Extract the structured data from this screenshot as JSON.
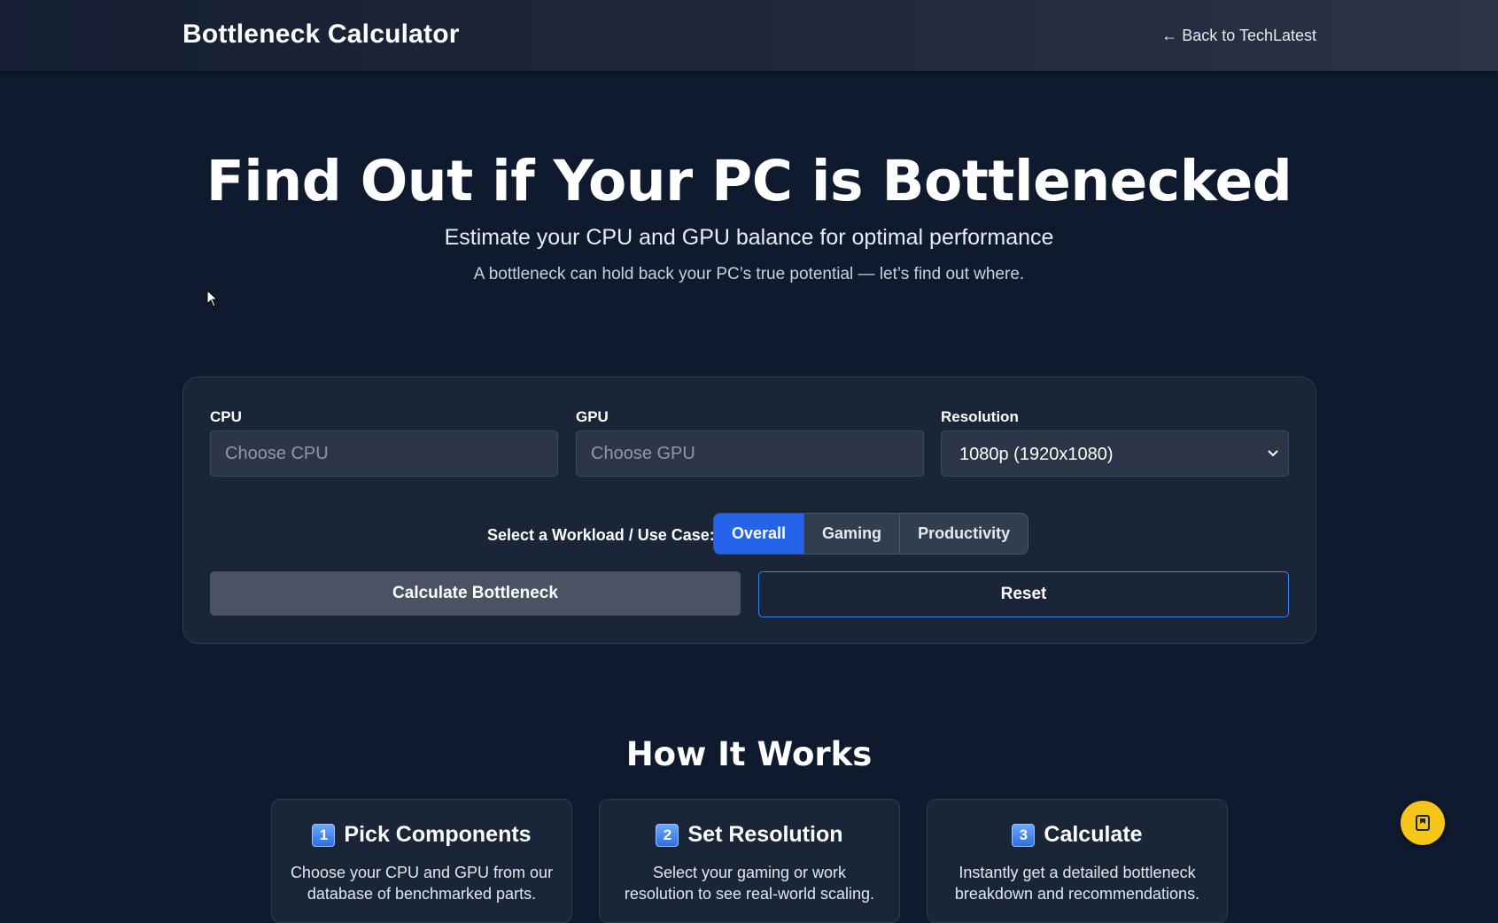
{
  "header": {
    "brand": "Bottleneck Calculator",
    "back_link": "← Back to TechLatest"
  },
  "hero": {
    "title": "Find Out if Your PC is Bottlenecked",
    "subtitle": "Estimate your CPU and GPU balance for optimal performance",
    "description": "A bottleneck can hold back your PC’s true potential — let’s find out where."
  },
  "form": {
    "cpu": {
      "label": "CPU",
      "placeholder": "Choose CPU",
      "value": ""
    },
    "gpu": {
      "label": "GPU",
      "placeholder": "Choose GPU",
      "value": ""
    },
    "resolution": {
      "label": "Resolution",
      "selected": "1080p (1920x1080)"
    },
    "workload": {
      "label": "Select a Workload / Use Case:",
      "options": [
        "Overall",
        "Gaming",
        "Productivity"
      ],
      "active": "Overall"
    },
    "calculate_label": "Calculate Bottleneck",
    "reset_label": "Reset"
  },
  "how_it_works": {
    "title": "How It Works",
    "steps": [
      {
        "number": "1",
        "title": "Pick Components",
        "description": "Choose your CPU and GPU from our database of benchmarked parts."
      },
      {
        "number": "2",
        "title": "Set Resolution",
        "description": "Select your gaming or work resolution to see real-world scaling."
      },
      {
        "number": "3",
        "title": "Calculate",
        "description": "Instantly get a detailed bottleneck breakdown and recommendations."
      }
    ]
  },
  "colors": {
    "background": "#0f1a2e",
    "card": "#1b2538",
    "accent": "#2563eb",
    "reset_border": "#3b82f6",
    "fab": "#f5c518"
  },
  "icons": {
    "cursor": "mouse-pointer-icon",
    "select_chevron": "chevron-down-icon",
    "fab": "bookmark-icon"
  }
}
